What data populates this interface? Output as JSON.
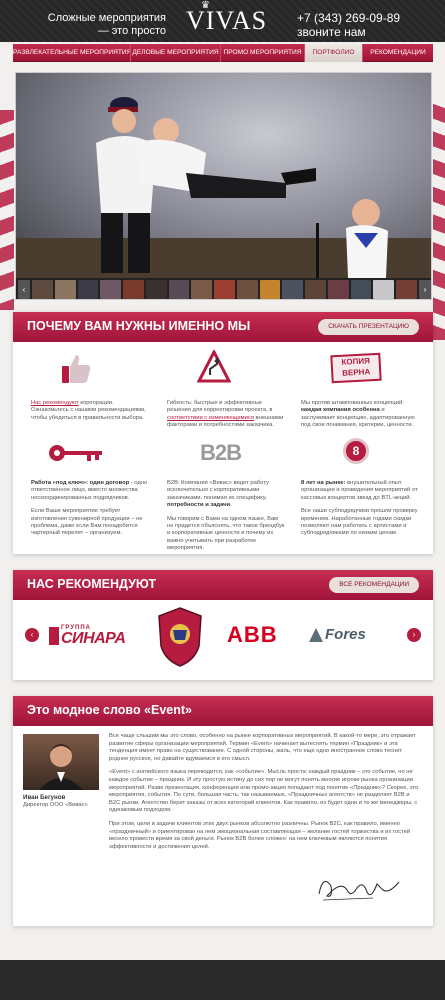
{
  "header": {
    "tagline": "Сложные мероприятия — это просто",
    "logo": "VIVAS",
    "phone": "+7 (343) 269-09-89",
    "phone_cta": "звоните нам"
  },
  "nav": [
    {
      "label": "РАЗВЛЕКАТЕЛЬНЫЕ МЕРОПРИЯТИЯ",
      "active": false
    },
    {
      "label": "ДЕЛОВЫЕ МЕРОПРИЯТИЯ",
      "active": false
    },
    {
      "label": "ПРОМО МЕРОПРИЯТИЯ",
      "active": false
    },
    {
      "label": "ПОРТФОЛИО",
      "active": true
    },
    {
      "label": "РЕКОМЕНДАЦИИ",
      "active": false
    }
  ],
  "why": {
    "title": "ПОЧЕМУ ВАМ НУЖНЫ ИМЕННО МЫ",
    "button": "СКАЧАТЬ ПРЕЗЕНТАЦИЮ",
    "f1_link": "Нас рекомендуют",
    "f1_text": " корпорации. Ознакомьтесь с нашими рекомендациями, чтобы убедиться в правильности выбора.",
    "f2_text1": "Гибкость: быстрые и эффективные решения для корректировки проекта, в ",
    "f2_link": "соответствии с изменяющимися",
    "f2_text2": " внешними факторами и потребностями заказчика.",
    "f3_text1": "Мы против штампованных концепций: ",
    "f3_bold": "каждая компания особенна",
    "f3_text2": " и заслуживает концепцию, адаптированную под свои понимания, критерии, ценности.",
    "f3_icon_label1": "КОПИЯ",
    "f3_icon_label2": "ВЕРНА",
    "f4_bold1": "Работа «под ключ»: один договор",
    "f4_text1": " - одно ответственное лицо, вместо множества нескоординированных подрядчиков.",
    "f4_text2": "Если Ваше мероприятие требует изготовления сувенирной продукции – не проблема, даже если Вам понадобится чартерный перелет – организуем.",
    "f5_icon_label": "B2B",
    "f5_text1": "B2B: Компания «Вивас» ведет работу исключительно с корпоративными заказчиками, понимая их специфику, ",
    "f5_bold": "потребности и задачи",
    "f5_text2": ".",
    "f5_text3": "Мы говорим с Вами на одном языке, Вам не придется объяснять, что такое брендбук и корпоративные ценности и почему их важно учитывать при разработке мероприятия.",
    "f6_icon_label": "8",
    "f6_bold": "8 лет на рынке:",
    "f6_text1": " внушительный опыт организации и проведения мероприятий от кассовых концертов звезд до BTL-акций.",
    "f6_text2": "Все наши субподрядчики прошли проверку временем. Наработанные годами скидки позволяют нам работать с артистами и субподрядчиками по низким ценам."
  },
  "recommend": {
    "title": "НАС РЕКОМЕНДУЮТ",
    "button": "ВСЕ РЕКОМЕНДАЦИИ",
    "logo1_small": "ГРУППА",
    "logo1": "СИНАРА",
    "logo3": "ABB",
    "logo4": "Fores"
  },
  "article": {
    "title": "Это модное слово «Event»",
    "person_name": "Иван Бегунов",
    "person_role": "Директор ООО «Вивас»",
    "p1": "Все чаще слышим мы это слово, особенно на рынке корпоративных мероприятий. В какой-то мере, это отражает развитие сферы организации мероприятий. Термин «Event» начинает вытеснять термин «Праздник» и эта тенденция имеет право на существование. С одной стороны, жаль, что еще одно иностранное слово теснит родное русское, но давайте вдумаемся в его смысл.",
    "p2": "«Event» с английского языка переводится, как «событие». Мысль проста: каждый праздник – это событие, но не каждое событие – праздник. И эту простую истину до сих пор не могут понять многие игроки рынка организации мероприятий. Разве презентация, конференция или промо-акция попадают под понятие «Праздник»? Скорее, это мероприятия, события. По сути, большая часть, так называемых, «Праздничных агентств» не разделяет B2B и B2C рынки. Агентство берет заказы от всех категорий клиентов. Как правило, из будет одни и те же менеджеры, с одинаковым подходом.",
    "p3": "При этом, цели и задачи клиентов этих двух рынков абсолютно различны. Рынок B2C, как правило, именно «праздничный» и ориентирован на нем эмоциональная составляющая – желание гостей торжества и их гостей весело провести время за свой деньги. Рынок B2B более сложен: на нем ключевым являются понятия эффективности и достижения целей."
  },
  "colors": {
    "brand": "#b51c3f",
    "dark": "#2a2a2a"
  }
}
